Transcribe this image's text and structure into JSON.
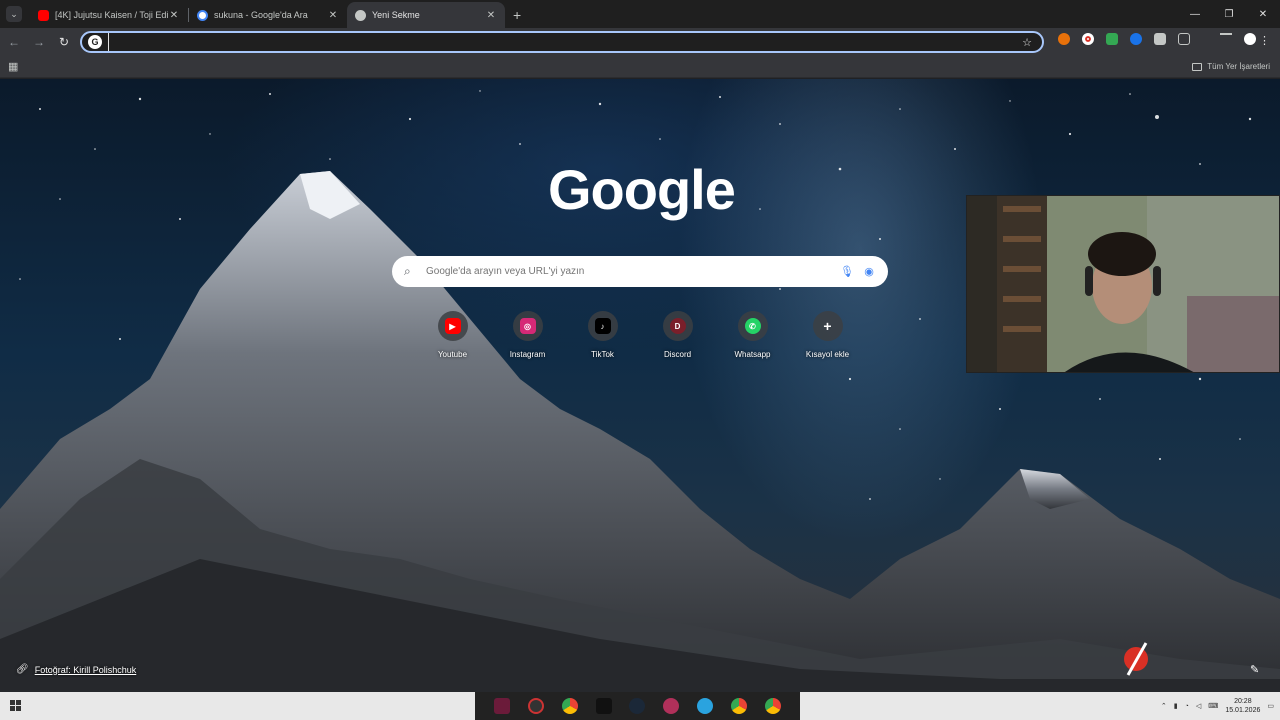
{
  "tabs": [
    {
      "title": "[4K] Jujutsu Kaisen / Toji Edit - \\",
      "favicon": "youtube-favicon",
      "color": "#ff0000"
    },
    {
      "title": "sukuna - Google'da Ara",
      "favicon": "google-favicon",
      "color": "#4285f4"
    },
    {
      "title": "Yeni Sekme",
      "favicon": "chrome-favicon",
      "color": "#c4c7c5"
    }
  ],
  "toolbar": {
    "omnibox_value": "",
    "back_icon": "back-arrow-icon",
    "forward_icon": "forward-arrow-icon",
    "reload_icon": "reload-icon"
  },
  "bookmarks": {
    "all_bookmarks_label": "Tüm Yer İşaretleri"
  },
  "newtab": {
    "logo_text": "Google",
    "search_placeholder": "Google'da arayın veya URL'yi yazın",
    "shortcuts": [
      {
        "label": "Youtube",
        "glyph": "▶",
        "color": "#ff0000"
      },
      {
        "label": "Instagram",
        "glyph": "◎",
        "color": "#d62976"
      },
      {
        "label": "TikTok",
        "glyph": "♪",
        "color": "#000000"
      },
      {
        "label": "Discord",
        "glyph": "D",
        "color": "#7a1f2a"
      },
      {
        "label": "Whatsapp",
        "glyph": "✆",
        "color": "#25d366"
      },
      {
        "label": "Kısayol ekle",
        "glyph": "+",
        "color": "transparent"
      }
    ],
    "photo_credit": "Fotoğraf: Kirill Polishchuk"
  },
  "taskbar": {
    "search_label": "",
    "time": "20:28",
    "date": "15.01.2026"
  }
}
